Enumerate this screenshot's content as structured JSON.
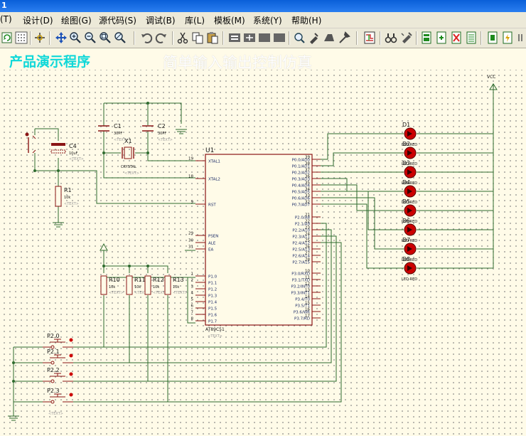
{
  "window": {
    "title": "1"
  },
  "menu": [
    "(T)",
    "设计(D)",
    "绘图(G)",
    "源代码(S)",
    "调试(B)",
    "库(L)",
    "模板(M)",
    "系统(Y)",
    "帮助(H)"
  ],
  "toolbar_icons": [
    "refresh-icon",
    "grid-icon",
    "origin-icon",
    "pan-icon",
    "zoom-in-icon",
    "zoom-out-icon",
    "zoom-all-icon",
    "zoom-area-icon",
    "undo-icon",
    "redo-icon",
    "cut-icon",
    "copy-icon",
    "paste-icon",
    "block-copy-icon",
    "block-move-icon",
    "block-rotate-icon",
    "block-delete-icon",
    "pick-device-icon",
    "make-device-icon",
    "package-icon",
    "decompose-icon",
    "wire-autorouter-icon",
    "search-tag-icon",
    "property-assign-icon",
    "new-sheet-icon",
    "remove-sheet-icon",
    "bom-icon",
    "netlist-icon",
    "erc-icon"
  ],
  "banner": {
    "left": "产品演示程序",
    "right": "简单输入输出控制仿真"
  },
  "schematic": {
    "vcc": "VCC",
    "text_placeholder": "<TEXT>",
    "u1": {
      "ref": "U1",
      "part": "AT89C51"
    },
    "u1_left_pins": [
      {
        "name": "XTAL1",
        "num": "19"
      },
      {
        "name": "XTAL2",
        "num": "18"
      },
      {
        "name": "RST",
        "num": "9"
      },
      {
        "name": "PSEN",
        "num": "29"
      },
      {
        "name": "ALE",
        "num": "30"
      },
      {
        "name": "EA",
        "num": "31"
      },
      {
        "name": "P1.0",
        "num": "1"
      },
      {
        "name": "P1.1",
        "num": "2"
      },
      {
        "name": "P1.2",
        "num": "3"
      },
      {
        "name": "P1.3",
        "num": "4"
      },
      {
        "name": "P1.4",
        "num": "5"
      },
      {
        "name": "P1.5",
        "num": "6"
      },
      {
        "name": "P1.6",
        "num": "7"
      },
      {
        "name": "P1.7",
        "num": "8"
      }
    ],
    "u1_right_pins": [
      {
        "name": "P0.0/AD0",
        "num": "39"
      },
      {
        "name": "P0.1/AD1",
        "num": "38"
      },
      {
        "name": "P0.2/AD2",
        "num": "37"
      },
      {
        "name": "P0.3/AD3",
        "num": "36"
      },
      {
        "name": "P0.4/AD4",
        "num": "35"
      },
      {
        "name": "P0.5/AD5",
        "num": "34"
      },
      {
        "name": "P0.6/AD6",
        "num": "33"
      },
      {
        "name": "P0.7/AD7",
        "num": "32"
      },
      {
        "name": "P2.0/A8",
        "num": "21"
      },
      {
        "name": "P2.1/A9",
        "num": "22"
      },
      {
        "name": "P2.2/A10",
        "num": "23"
      },
      {
        "name": "P2.3/A11",
        "num": "24"
      },
      {
        "name": "P2.4/A12",
        "num": "25"
      },
      {
        "name": "P2.5/A13",
        "num": "26"
      },
      {
        "name": "P2.6/A14",
        "num": "27"
      },
      {
        "name": "P2.7/A15",
        "num": "28"
      },
      {
        "name": "P3.0/RXD",
        "num": "10"
      },
      {
        "name": "P3.1/TXD",
        "num": "11"
      },
      {
        "name": "P3.2/INT0",
        "num": "12"
      },
      {
        "name": "P3.3/INT1",
        "num": "13"
      },
      {
        "name": "P3.4/T0",
        "num": "14"
      },
      {
        "name": "P3.5/T1",
        "num": "15"
      },
      {
        "name": "P3.6/WR",
        "num": "16"
      },
      {
        "name": "P3.7/RD",
        "num": "17"
      }
    ],
    "c1": {
      "ref": "C1",
      "value": "30PF"
    },
    "c2": {
      "ref": "C2",
      "value": "30PF"
    },
    "c4": {
      "ref": "C4",
      "value": "10uF"
    },
    "x1": {
      "ref": "X1",
      "value": "CRYSTAL"
    },
    "r1": {
      "ref": "R1",
      "value": "10k"
    },
    "resistors": [
      {
        "ref": "R10",
        "value": "10k"
      },
      {
        "ref": "R11",
        "value": "10k"
      },
      {
        "ref": "R12",
        "value": "10k"
      },
      {
        "ref": "R13",
        "value": "10k"
      }
    ],
    "leds": [
      {
        "ref": "D1",
        "value": "LED-RED"
      },
      {
        "ref": "D2",
        "value": "LED-RED"
      },
      {
        "ref": "D3",
        "value": "LED-RED"
      },
      {
        "ref": "D4",
        "value": "LED-RED"
      },
      {
        "ref": "D5",
        "value": "LED-RED"
      },
      {
        "ref": "D6",
        "value": "LED-RED"
      },
      {
        "ref": "D7",
        "value": "LED-RED"
      },
      {
        "ref": "D8",
        "value": "LED-RED"
      }
    ],
    "buttons": [
      {
        "ref": "P2.0"
      },
      {
        "ref": "P2.1"
      },
      {
        "ref": "P2.2"
      },
      {
        "ref": "P2.3"
      }
    ],
    "colors": {
      "wire": "#2e6b2e",
      "component": "#8a1515",
      "led": "#cc0000",
      "pin_text": "#1a2a66",
      "label_text": "#151515",
      "text_tag": "#9a9a9a"
    }
  }
}
